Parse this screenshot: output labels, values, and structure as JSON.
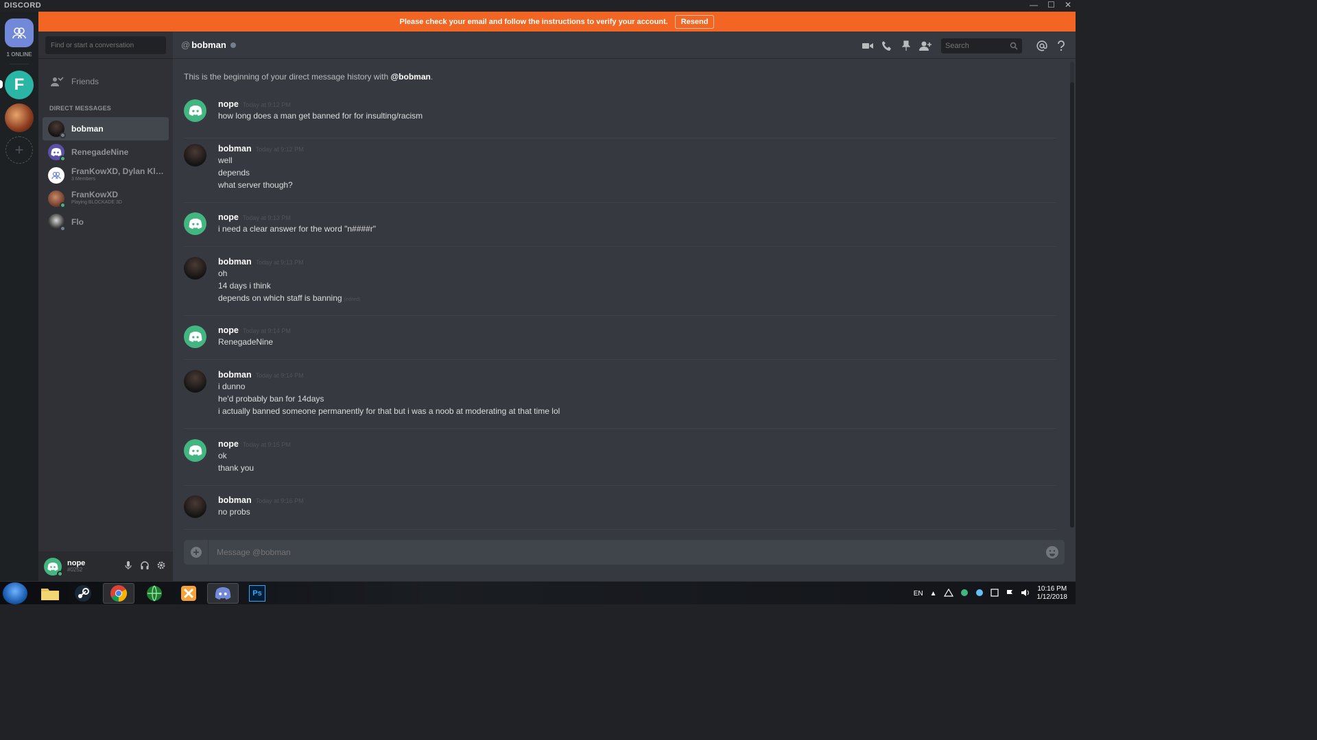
{
  "app": {
    "brand": "DISCORD"
  },
  "window": {
    "minimize": "—",
    "maximize": "☐",
    "close": "✕"
  },
  "guilds": {
    "online_count": "1 ONLINE",
    "server_letter": "F",
    "add": "+"
  },
  "banner": {
    "text": "Please check your email and follow the instructions to verify your account.",
    "button": "Resend"
  },
  "dm_sidebar": {
    "search_placeholder": "Find or start a conversation",
    "friends_label": "Friends",
    "header": "DIRECT MESSAGES",
    "items": [
      {
        "name": "bobman",
        "sub": "",
        "status": "grey",
        "active": true
      },
      {
        "name": "RenegadeNine",
        "sub": "",
        "status": "green",
        "active": false
      },
      {
        "name": "FranKowXD, Dylan Kleb...",
        "sub": "3 Members",
        "status": "",
        "active": false
      },
      {
        "name": "FranKowXD",
        "sub": "Playing BLOCKADE 3D",
        "status": "green",
        "active": false
      },
      {
        "name": "Flo",
        "sub": "",
        "status": "grey",
        "active": false
      }
    ]
  },
  "user_panel": {
    "name": "nope",
    "tag": "#0252"
  },
  "chat": {
    "header": {
      "at": "@",
      "name": "bobman"
    },
    "search_placeholder": "Search",
    "intro_prefix": "This is the beginning of your direct message history with ",
    "intro_user": "@bobman",
    "intro_suffix": ".",
    "messages": [
      {
        "author": "nope",
        "time": "Today at 9:12 PM",
        "lines": [
          "how long does a man get banned for for insulting/racism"
        ]
      },
      {
        "author": "bobman",
        "time": "Today at 9:12 PM",
        "lines": [
          "well",
          "depends",
          "what server though?"
        ]
      },
      {
        "author": "nope",
        "time": "Today at 9:13 PM",
        "lines": [
          "i need a clear answer for the word \"n####r\""
        ]
      },
      {
        "author": "bobman",
        "time": "Today at 9:13 PM",
        "lines": [
          "oh",
          "14 days i think",
          "depends on which staff is banning"
        ],
        "edited": "(edited)"
      },
      {
        "author": "nope",
        "time": "Today at 9:14 PM",
        "lines": [
          "RenegadeNine"
        ]
      },
      {
        "author": "bobman",
        "time": "Today at 9:14 PM",
        "lines": [
          "i dunno",
          "he'd probably ban for 14days",
          "i actually banned someone permanently for that but i was a noob at moderating at that time lol"
        ]
      },
      {
        "author": "nope",
        "time": "Today at 9:15 PM",
        "lines": [
          "ok",
          "thank you"
        ]
      },
      {
        "author": "bobman",
        "time": "Today at 9:16 PM",
        "lines": [
          "no probs"
        ]
      }
    ],
    "composer_placeholder": "Message @bobman"
  },
  "taskbar": {
    "lang": "EN",
    "time": "10:16 PM",
    "date": "1/12/2018",
    "ps_label": "Ps"
  },
  "colors": {
    "banner": "#f26522",
    "accent": "#7289da",
    "online": "#43b581",
    "offline": "#747f8d"
  }
}
